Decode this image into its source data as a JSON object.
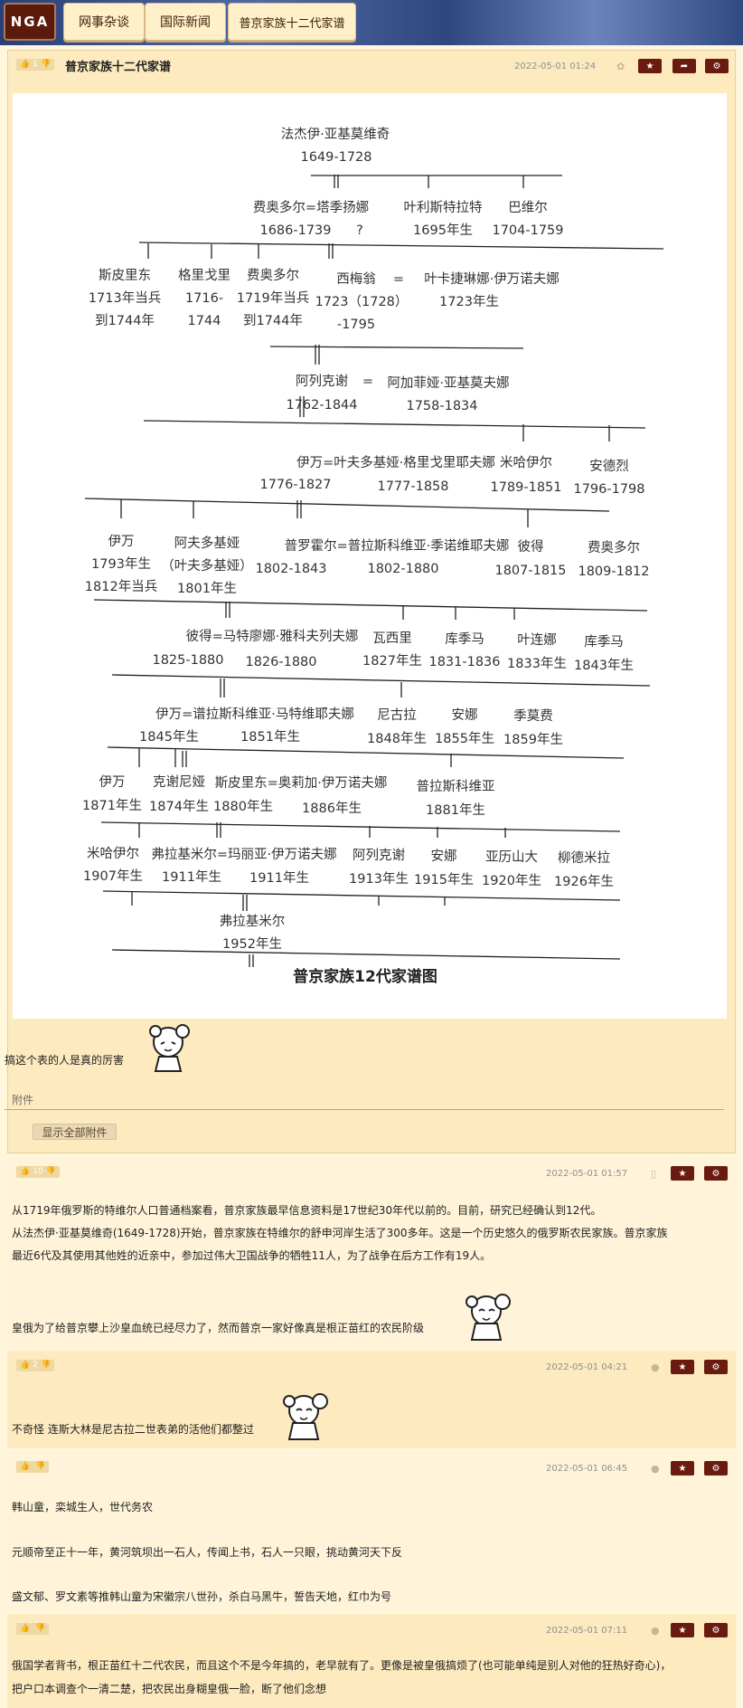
{
  "nav": {
    "logo": "NGA",
    "tabs": [
      "网事杂谈",
      "国际新闻",
      "普京家族十二代家谱"
    ]
  },
  "posts": [
    {
      "likes": "1",
      "title": "普京家族十二代家谱",
      "date": "2022-05-01 01:24",
      "text": [
        "搞这个表的人是真的厉害"
      ]
    },
    {
      "likes": "10",
      "date": "2022-05-01 01:57",
      "text": [
        "从1719年俄罗斯的特维尔人口普通档案看，普京家族最早信息资料是17世纪30年代以前的。目前，研究已经确认到12代。",
        "从法杰伊·亚基莫维奇(1649-1728)开始，普京家族在特维尔的舒申河岸生活了300多年。这是一个历史悠久的俄罗斯农民家族。普京家族",
        "最近6代及其使用其他姓的近亲中，参加过伟大卫国战争的牺牲11人，为了战争在后方工作有19人。",
        "皇俄为了给普京攀上沙皇血统已经尽力了，然而普京一家好像真是根正苗红的农民阶级"
      ]
    },
    {
      "likes": "2",
      "date": "2022-05-01 04:21",
      "text": [
        "不奇怪 连斯大林是尼古拉二世表弟的活他们都整过"
      ]
    },
    {
      "likes": "",
      "date": "2022-05-01 06:45",
      "text": [
        "韩山童，栾城生人，世代务农",
        "元顺帝至正十一年，黄河筑坝出一石人，传闻上书，石人一只眼，挑动黄河天下反",
        "盛文郁、罗文素等推韩山童为宋徽宗八世孙，杀白马黑牛，誓告天地，红巾为号"
      ]
    },
    {
      "likes": "",
      "date": "2022-05-01 07:11",
      "text": [
        "俄国学者背书，根正苗红十二代农民，而且这个不是今年搞的，老早就有了。更像是被皇俄搞烦了(也可能单纯是别人对他的狂热好奇心)，",
        "把户口本调查个一清二楚，把农民出身糊皇俄一脸，断了他们念想"
      ]
    }
  ],
  "attachments": {
    "label": "附件",
    "button": "显示全部附件"
  },
  "diagram": {
    "title": "普京家族12代家谱图",
    "labels": [
      "法杰伊·亚基莫维奇",
      "1649-1728",
      "费奥多尔=塔季扬娜",
      "1686-1739",
      "?",
      "叶利斯特拉特",
      "1695年生",
      "巴维尔",
      "1704-1759",
      "斯皮里东",
      "1713年当兵",
      "到1744年",
      "格里戈里",
      "1716-",
      "1744",
      "费奥多尔",
      "1719年当兵",
      "到1744年",
      "西梅翁",
      "1723（1728）",
      "-1795",
      "=",
      "叶卡捷琳娜·伊万诺夫娜",
      "1723年生",
      "阿列克谢",
      "=",
      "阿加菲娅·亚基莫夫娜",
      "1762-1844",
      "1758-1834",
      "伊万=叶夫多基娅·格里戈里耶夫娜",
      "1776-1827",
      "1777-1858",
      "米哈伊尔",
      "1789-1851",
      "安德烈",
      "1796-1798",
      "伊万",
      "1793年生",
      "1812年当兵",
      "阿夫多基娅",
      "（叶夫多基娅）",
      "1801年生",
      "普罗霍尔=普拉斯科维亚·季诺维耶夫娜",
      "1802-1843",
      "1802-1880",
      "彼得",
      "1807-1815",
      "费奥多尔",
      "1809-1812",
      "彼得=马特廖娜·雅科夫列夫娜",
      "1825-1880",
      "1826-1880",
      "瓦西里",
      "1827年生",
      "库季马",
      "1831-1836",
      "叶连娜",
      "1833年生",
      "库季马",
      "1843年生",
      "伊万=谱拉斯科维亚·马特维耶夫娜",
      "1845年生",
      "1851年生",
      "尼古拉",
      "1848年生",
      "安娜",
      "1855年生",
      "季莫费",
      "1859年生",
      "伊万",
      "1871年生",
      "克谢尼娅",
      "1874年生",
      "斯皮里东=奥莉加·伊万诺夫娜",
      "1880年生",
      "1886年生",
      "普拉斯科维亚",
      "1881年生",
      "米哈伊尔",
      "1907年生",
      "弗拉基米尔=玛丽亚·伊万诺夫娜",
      "1911年生",
      "1911年生",
      "阿列克谢",
      "1913年生",
      "安娜",
      "1915年生",
      "亚历山大",
      "1920年生",
      "柳德米拉",
      "1926年生",
      "弗拉基米尔",
      "1952年生"
    ]
  }
}
